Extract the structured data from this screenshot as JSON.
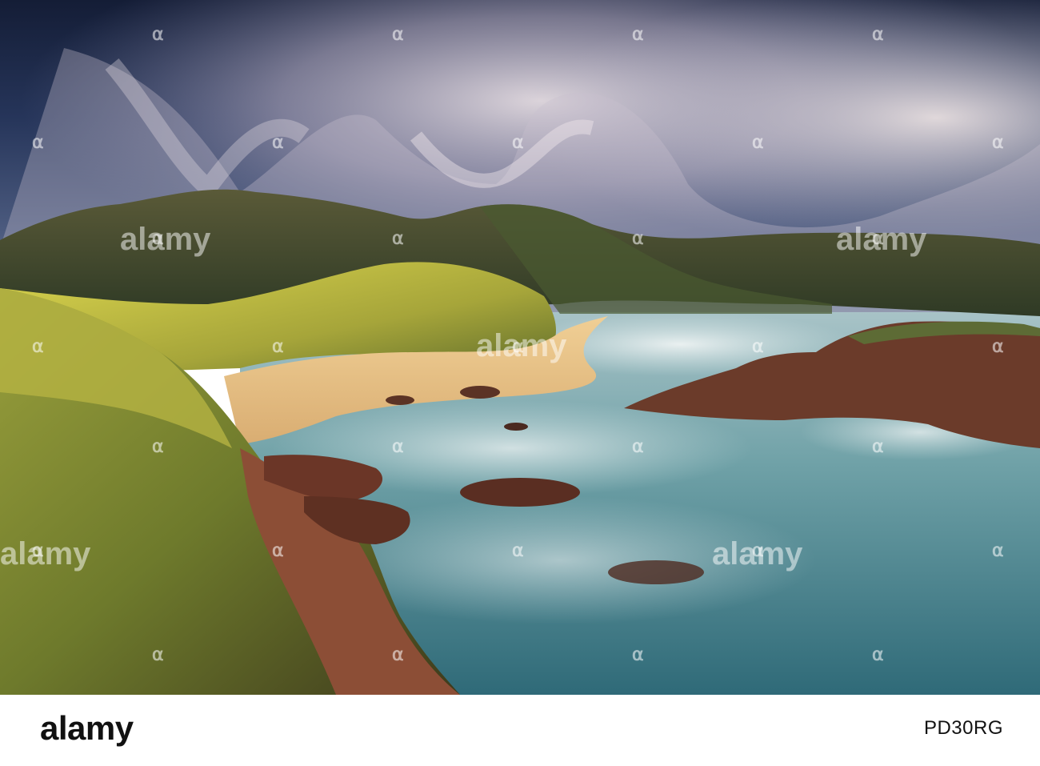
{
  "photo": {
    "subject": "coastal cove with golden sandy beach, grassy headlands, rocky shore and misty long-exposure sea under stormy clouds"
  },
  "watermark": {
    "text": "alamy",
    "center_text": "alamy",
    "icon": "alamy-a-logo-icon"
  },
  "footer": {
    "logo": "alamy",
    "image_id": "PD30RG"
  },
  "colors": {
    "sky_dark": "#1c2a4a",
    "cloud": "#d9d2dd",
    "grass": "#c6c04a",
    "sand": "#e7c48c",
    "rock": "#8a4e34",
    "sea": "#6fa5aa"
  }
}
